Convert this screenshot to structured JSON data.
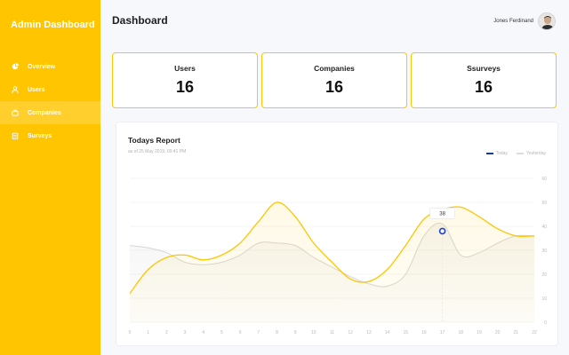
{
  "sidebar": {
    "brand": "Admin Dashboard",
    "items": [
      {
        "label": "Overview",
        "icon": "pie-chart-icon",
        "active": false
      },
      {
        "label": "Users",
        "icon": "user-icon",
        "active": false
      },
      {
        "label": "Companies",
        "icon": "briefcase-icon",
        "active": true
      },
      {
        "label": "Surveys",
        "icon": "clipboard-icon",
        "active": false
      }
    ]
  },
  "header": {
    "title": "Dashboard",
    "user_name": "Jones Ferdinand"
  },
  "stats": [
    {
      "label": "Users",
      "value": "16"
    },
    {
      "label": "Companies",
      "value": "16"
    },
    {
      "label": "Ssurveys",
      "value": "16"
    }
  ],
  "report": {
    "title": "Todays Report",
    "subtitle": "as of 25 May 2019, 09:41 PM"
  },
  "colors": {
    "accent": "#ffc500",
    "today": "#1a3a8f",
    "yesterday": "#dcdcdc"
  },
  "chart_data": {
    "type": "line",
    "x": [
      0,
      1,
      2,
      3,
      4,
      5,
      6,
      7,
      8,
      9,
      10,
      11,
      12,
      13,
      14,
      15,
      16,
      17,
      18,
      19,
      20,
      21,
      22
    ],
    "ylim": [
      0,
      60
    ],
    "y_ticks": [
      "0",
      "10",
      "20",
      "30",
      "40",
      "50",
      "60"
    ],
    "x_tick_labels": [
      "0",
      "1",
      "2",
      "3",
      "4",
      "5",
      "6",
      "7",
      "8",
      "9",
      "10",
      "11",
      "12",
      "13",
      "14",
      "15",
      "16",
      "17",
      "18",
      "19",
      "20",
      "21",
      "22"
    ],
    "grid": true,
    "legend_position": "top-right",
    "series": [
      {
        "name": "Today",
        "values": [
          12,
          22,
          27,
          28,
          26,
          28,
          33,
          42,
          50,
          44,
          33,
          25,
          18,
          17,
          22,
          32,
          43,
          47,
          48,
          44,
          39,
          36,
          36
        ]
      },
      {
        "name": "Yesterday",
        "values": [
          32,
          31,
          29,
          25,
          24,
          25,
          28,
          33,
          33,
          32,
          27,
          23,
          19,
          16,
          15,
          20,
          36,
          41,
          28,
          29,
          33,
          36,
          36
        ]
      }
    ],
    "tooltip": {
      "x": 17,
      "value": "38"
    }
  }
}
